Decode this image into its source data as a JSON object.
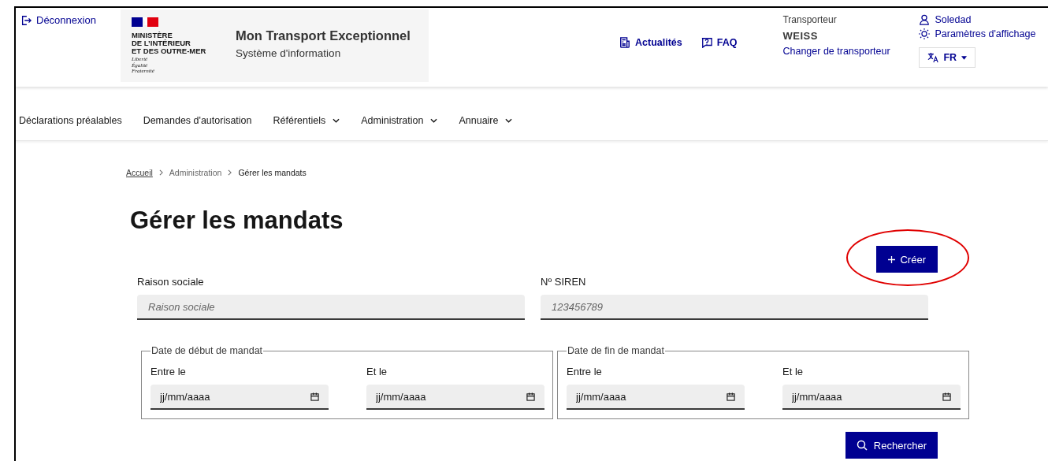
{
  "header": {
    "logout": "Déconnexion",
    "ministry": [
      "MINISTÈRE",
      "DE L’INTÉRIEUR",
      "ET DES OUTRE-MER"
    ],
    "motto": [
      "Liberté",
      "Égalité",
      "Fraternité"
    ],
    "site_title": "Mon Transport Exceptionnel",
    "site_subtitle": "Système d'information",
    "links": [
      {
        "label": "Actualités",
        "kind": "news"
      },
      {
        "label": "FAQ",
        "kind": "faq"
      }
    ],
    "carrier": {
      "label": "Transporteur",
      "name": "WEISS",
      "change": "Changer de transporteur"
    },
    "user": "Soledad",
    "display_settings": "Paramètres d'affichage",
    "language": "FR"
  },
  "nav": [
    {
      "label": "Déclarations préalables",
      "dropdown": false
    },
    {
      "label": "Demandes d'autorisation",
      "dropdown": false
    },
    {
      "label": "Référentiels",
      "dropdown": true
    },
    {
      "label": "Administration",
      "dropdown": true
    },
    {
      "label": "Annuaire",
      "dropdown": true
    }
  ],
  "breadcrumb": [
    "Accueil",
    "Administration",
    "Gérer les mandats"
  ],
  "title": "Gérer les mandats",
  "create_button": "Créer",
  "fields": [
    {
      "label": "Raison sociale",
      "placeholder": "Raison sociale"
    },
    {
      "label": "Nº SIREN",
      "placeholder": "123456789"
    }
  ],
  "date_groups": [
    {
      "legend": "Date de début de mandat",
      "inputs": [
        {
          "label": "Entre le",
          "placeholder": "jj/mm/aaaa"
        },
        {
          "label": "Et le",
          "placeholder": "jj/mm/aaaa"
        }
      ]
    },
    {
      "legend": "Date de fin de mandat",
      "inputs": [
        {
          "label": "Entre le",
          "placeholder": "jj/mm/aaaa"
        },
        {
          "label": "Et le",
          "placeholder": "jj/mm/aaaa"
        }
      ]
    }
  ],
  "search_button": "Rechercher"
}
